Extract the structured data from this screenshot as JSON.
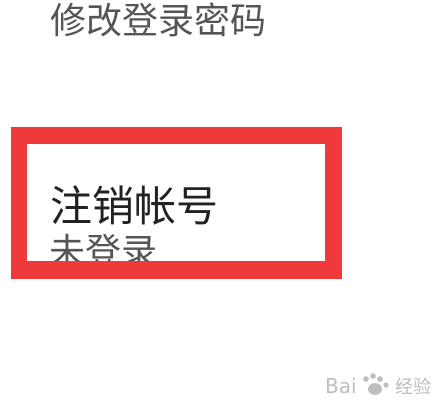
{
  "settings": {
    "change_password_label": "修改登录密码",
    "cancel_account": {
      "title": "注销帐号",
      "status": "未登录"
    }
  },
  "watermark": {
    "text": "Bai经验",
    "icon": "paw-logo-icon",
    "color": "#b8b8b8"
  },
  "colors": {
    "highlight": "#ee3a3a",
    "primary_text": "#222222",
    "secondary_text": "#555555"
  }
}
